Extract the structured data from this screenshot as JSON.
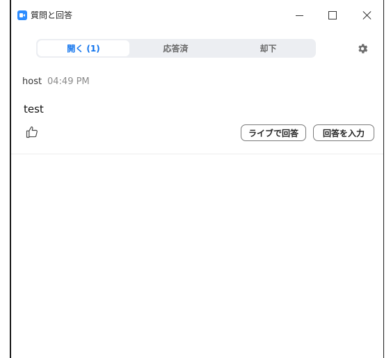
{
  "window": {
    "title": "質問と回答",
    "controls": {
      "minimize": "minimize",
      "maximize": "maximize",
      "close": "close"
    }
  },
  "tabs": [
    {
      "label": "開く (1)",
      "selected": true
    },
    {
      "label": "応答済",
      "selected": false
    },
    {
      "label": "却下",
      "selected": false
    }
  ],
  "settings": {
    "icon": "gear-icon"
  },
  "questions": [
    {
      "author": "host",
      "time": "04:49 PM",
      "text": "test",
      "like_icon": "thumbs-up-icon",
      "actions": {
        "answer_live": "ライブで回答",
        "type_answer": "回答を入力"
      }
    }
  ],
  "colors": {
    "accent": "#0e72ed",
    "app_icon": "#2d8cff",
    "tab_bar": "#eceef2",
    "frame": "#1a1a1a"
  }
}
